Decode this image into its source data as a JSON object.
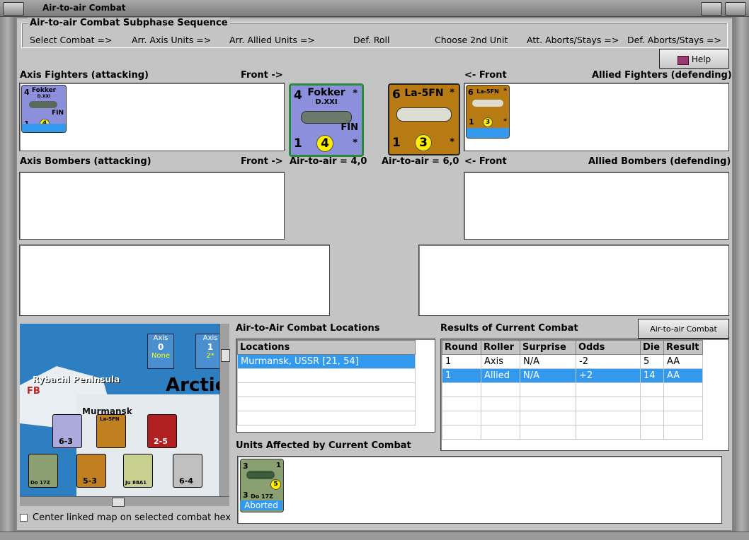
{
  "window": {
    "title": "Air-to-air Combat"
  },
  "sequence": {
    "title": "Air-to-air Combat Subphase Sequence",
    "steps": [
      "Select Combat =>",
      "Arr. Axis Units =>",
      "Arr. Allied Units =>",
      "Def. Roll",
      "Choose 2nd Unit",
      "Att. Aborts/Stays =>",
      "Def. Aborts/Stays =>"
    ]
  },
  "help_label": "Help",
  "axis_fighters": {
    "label": "Axis Fighters (attacking)",
    "front": "Front ->"
  },
  "allied_fighters": {
    "label": "Allied Fighters (defending)",
    "front": "<- Front"
  },
  "axis_bombers": {
    "label": "Axis Bombers (attacking)",
    "front": "Front ->"
  },
  "allied_bombers": {
    "label": "Allied Bombers (defending)",
    "front": "<- Front"
  },
  "axis_counter": {
    "name": "Fokker",
    "model": "D.XXI",
    "nation": "FIN",
    "tl": "4",
    "bl": "1",
    "star": "*",
    "rating": "4"
  },
  "allied_counter": {
    "name": "La-5FN",
    "tl": "6",
    "bl": "1",
    "star": "*",
    "rating": "3"
  },
  "axis_a2a": "Air-to-air = 4,0",
  "allied_a2a": "Air-to-air = 6,0",
  "locations": {
    "title": "Air-to-Air Combat Locations",
    "header": "Locations",
    "rows": [
      "Murmansk, USSR [21, 54]"
    ]
  },
  "results": {
    "title": "Results of Current Combat",
    "chart_button": "Air-to-air Combat Chart",
    "headers": [
      "Round",
      "Roller",
      "Surprise",
      "Odds",
      "Die",
      "Result"
    ],
    "rows": [
      [
        "1",
        "Axis",
        "N/A",
        "-2",
        "5",
        "AA"
      ],
      [
        "1",
        "Allied",
        "N/A",
        "+2",
        "14",
        "AA"
      ]
    ]
  },
  "affected": {
    "title": "Units Affected by Current Combat",
    "unit": {
      "tl": "3",
      "bl": "3",
      "tr": "1",
      "name": "Do 17Z",
      "rating": "5",
      "status": "Aborted"
    }
  },
  "map": {
    "axis_box": {
      "label": "Axis",
      "value": "0",
      "sub": "None"
    },
    "axis_box2": {
      "label": "Axis",
      "value": "1",
      "sub": "2*"
    },
    "place1": "Rybachi Peninsula",
    "place2": "Arctic",
    "place3": "Murmansk",
    "fb": "FB",
    "units": {
      "u1": "6-3",
      "u2": "2-5",
      "u3": "5-3",
      "u4": "6-4",
      "u5": "Do 17Z",
      "u6": "Ju 88A1",
      "u7": "La-5FN"
    }
  },
  "center_checkbox_label": "Center linked map on selected combat hex"
}
